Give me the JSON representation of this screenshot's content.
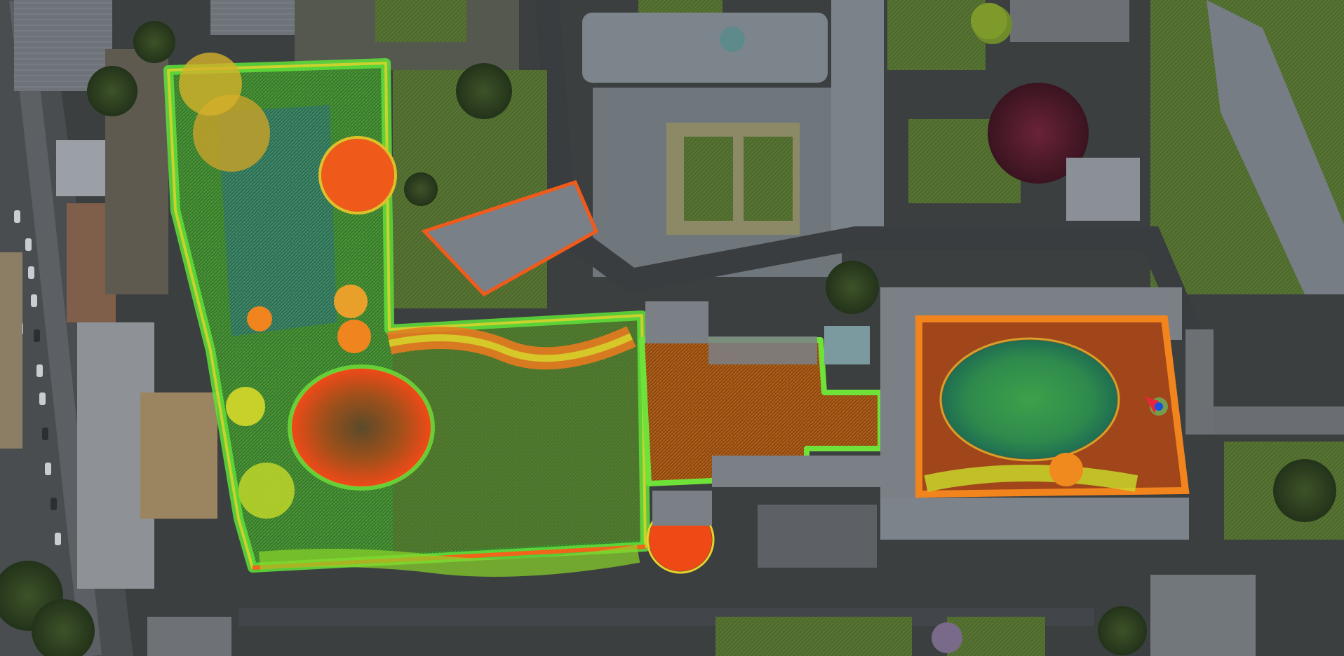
{
  "view": {
    "mode": "aerial-satellite",
    "overlay": "lidar-point-cloud",
    "overlay_colormap": [
      "#2a7fd4",
      "#21c49a",
      "#4ed62a",
      "#c8d62a",
      "#f29a1e",
      "#ef4a16"
    ],
    "sensor_marker_colors": {
      "body": "#1c4fe0",
      "heading": "#e8283a",
      "halo": "#58d86a"
    }
  },
  "legend": [],
  "labels": []
}
